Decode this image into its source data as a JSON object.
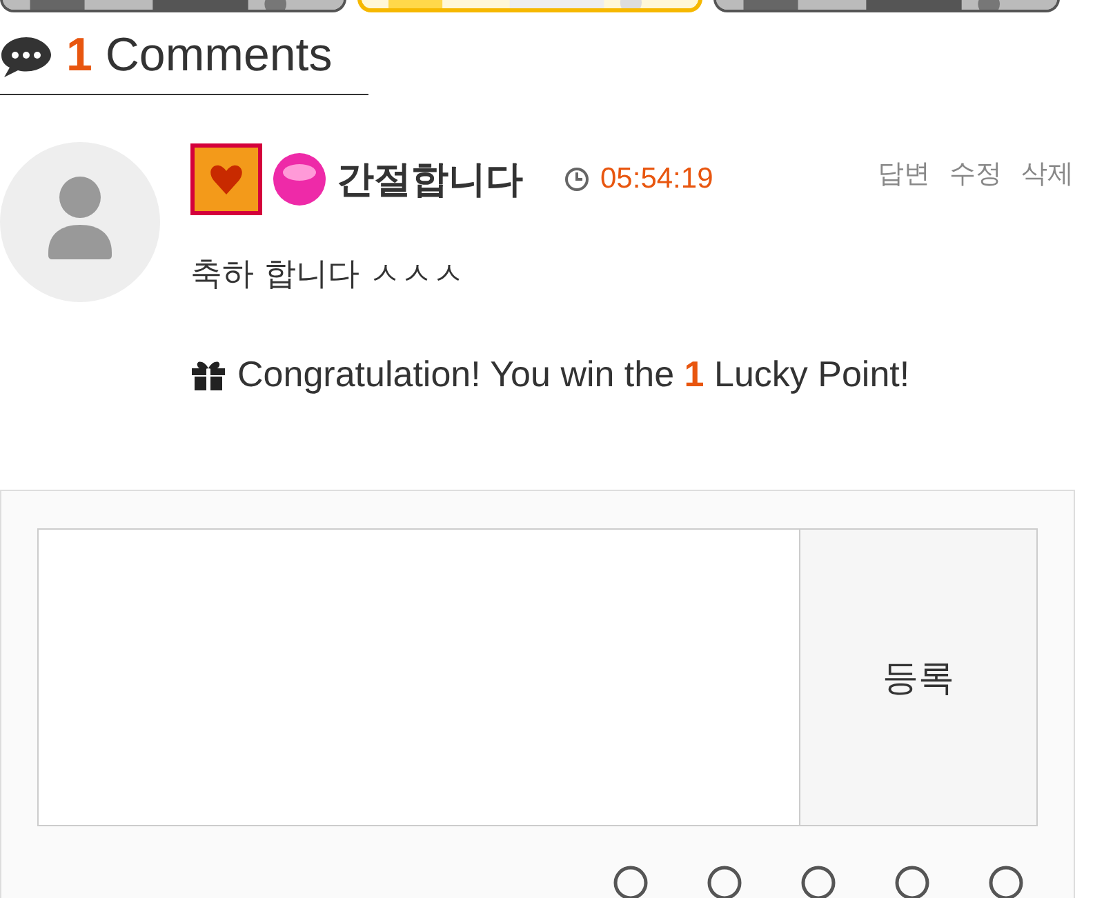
{
  "top_buttons": [
    {
      "kind": "picture",
      "selected": false
    },
    {
      "kind": "picture",
      "selected": true
    },
    {
      "kind": "picture",
      "selected": false
    }
  ],
  "comments_header": {
    "count": "1",
    "label": "Comments"
  },
  "comment": {
    "author": "간절합니다",
    "time": "05:54:19",
    "actions": [
      "답변",
      "수정",
      "삭제"
    ],
    "text": "축하 합니다 ㅅㅅㅅ",
    "reward": "Congratulation! You win the **1** Lucky Point!"
  },
  "form": {
    "submit": "등록"
  }
}
